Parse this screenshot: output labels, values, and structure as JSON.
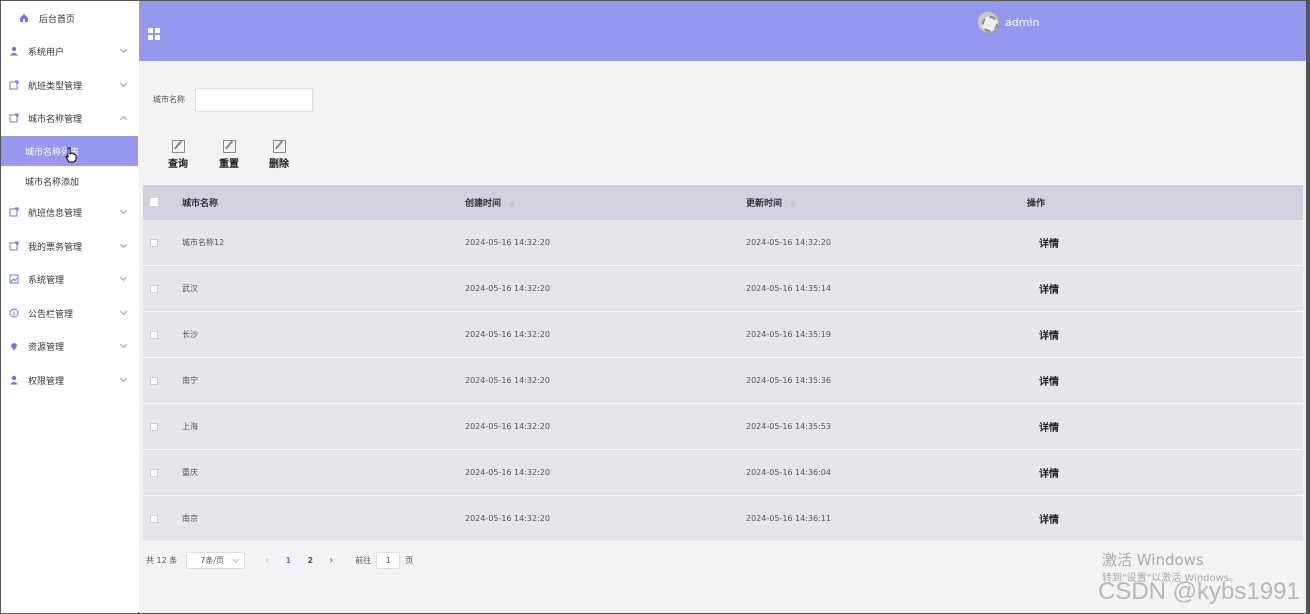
{
  "sidebar": {
    "items": [
      {
        "label": "后台首页",
        "icon": "home-icon"
      },
      {
        "label": "系统用户",
        "icon": "user-icon"
      },
      {
        "label": "航班类型管理",
        "icon": "folder-icon"
      },
      {
        "label": "城市名称管理",
        "icon": "folder-icon"
      },
      {
        "label": "航班信息管理",
        "icon": "folder-icon"
      },
      {
        "label": "我的票务管理",
        "icon": "folder-icon"
      },
      {
        "label": "系统管理",
        "icon": "image-icon"
      },
      {
        "label": "公告栏管理",
        "icon": "info-icon"
      },
      {
        "label": "资源管理",
        "icon": "pin-icon"
      },
      {
        "label": "权限管理",
        "icon": "user-icon"
      }
    ],
    "sub_items": [
      {
        "label": "城市名称列表",
        "active": true
      },
      {
        "label": "城市名称添加",
        "active": false
      }
    ]
  },
  "header": {
    "username": "admin"
  },
  "search": {
    "label": "城市名称",
    "value": ""
  },
  "toolbar": {
    "query_label": "查询",
    "reset_label": "重置",
    "delete_label": "删除"
  },
  "table": {
    "columns": [
      "城市名称",
      "创建时间",
      "更新时间",
      "操作"
    ],
    "rows": [
      {
        "name": "城市名称12",
        "created": "2024-05-16 14:32:20",
        "updated": "2024-05-16 14:32:20",
        "action": "详情"
      },
      {
        "name": "武汉",
        "created": "2024-05-16 14:32:20",
        "updated": "2024-05-16 14:35:14",
        "action": "详情"
      },
      {
        "name": "长沙",
        "created": "2024-05-16 14:32:20",
        "updated": "2024-05-16 14:35:19",
        "action": "详情"
      },
      {
        "name": "南宁",
        "created": "2024-05-16 14:32:20",
        "updated": "2024-05-16 14:35:36",
        "action": "详情"
      },
      {
        "name": "上海",
        "created": "2024-05-16 14:32:20",
        "updated": "2024-05-16 14:35:53",
        "action": "详情"
      },
      {
        "name": "重庆",
        "created": "2024-05-16 14:32:20",
        "updated": "2024-05-16 14:36:04",
        "action": "详情"
      },
      {
        "name": "南京",
        "created": "2024-05-16 14:32:20",
        "updated": "2024-05-16 14:36:11",
        "action": "详情"
      }
    ]
  },
  "pagination": {
    "total": "共 12 条",
    "page_size": "7条/页",
    "pages": [
      "1",
      "2"
    ],
    "current_page": "1",
    "goto_label": "前往",
    "goto_value": "1",
    "page_suffix": "页"
  },
  "watermark": {
    "activate_title": "激活 Windows",
    "activate_hint": "转到\"设置\"以激活 Windows。",
    "csdn": "CSDN @kybs1991"
  },
  "colors": {
    "accent": "#9598ef",
    "active_menu": "#9699ee",
    "header_row": "#d1d1e0",
    "row_bg": "#e6e6ea"
  }
}
